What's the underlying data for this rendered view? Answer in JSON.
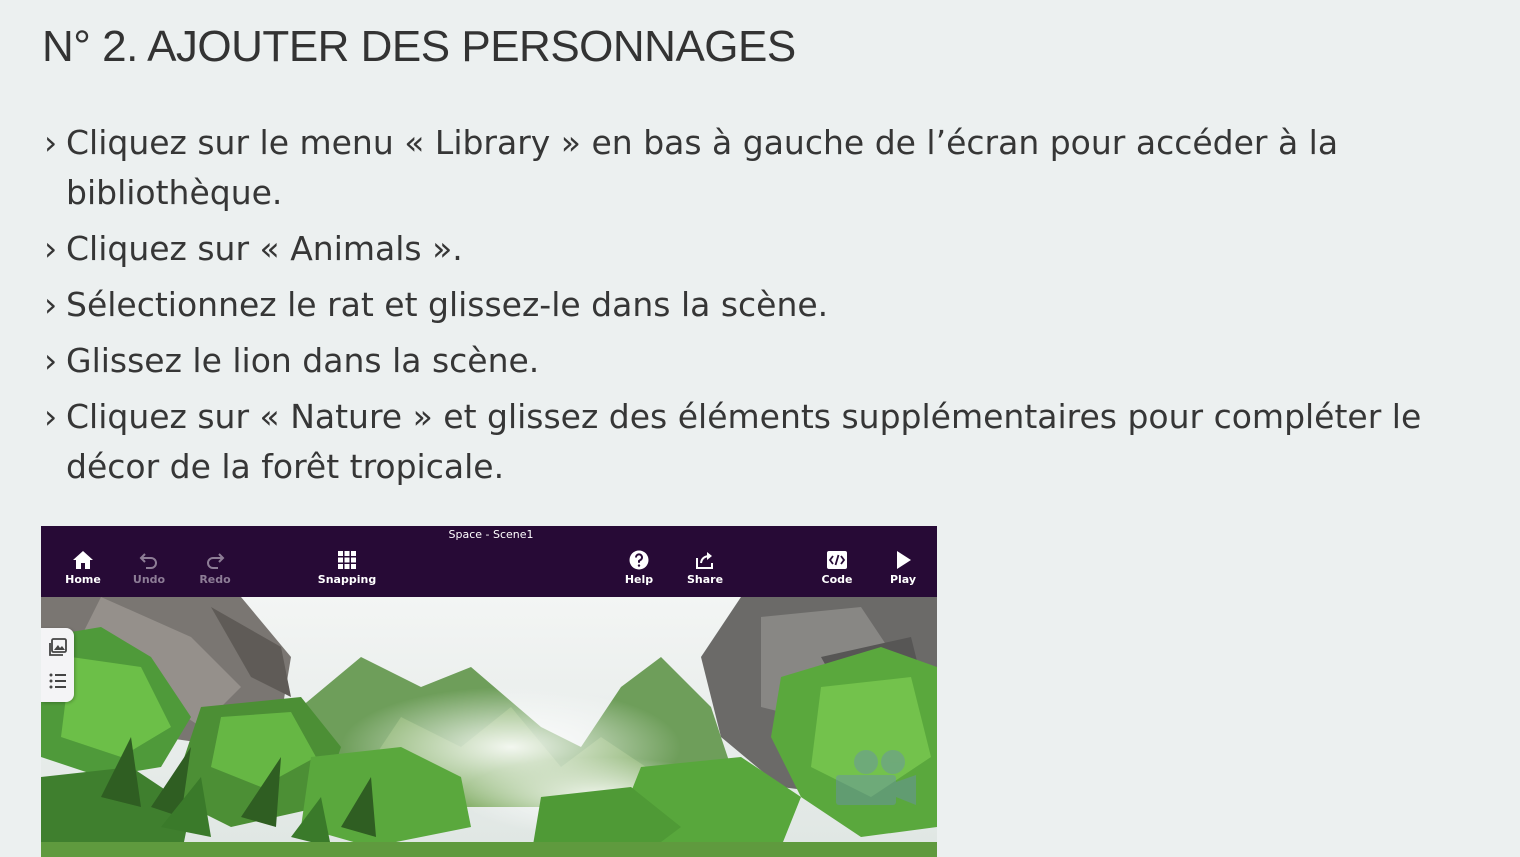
{
  "heading": "N° 2. AJOUTER DES PERSONNAGES",
  "step_marker": "›",
  "steps": [
    "Cliquez sur le menu « Library » en bas à gauche de l’écran pour accéder à la bibliothèque.",
    "Cliquez sur « Animals ».",
    "Sélectionnez le rat et glissez-le dans la scène.",
    "Glissez le lion dans la scène.",
    "Cliquez sur « Nature » et glissez des éléments supplémentaires pour compléter le décor de la forêt tropicale."
  ],
  "app": {
    "scene_title": "Space - Scene1",
    "toolbar": {
      "home": "Home",
      "undo": "Undo",
      "redo": "Redo",
      "snapping": "Snapping",
      "help": "Help",
      "share": "Share",
      "code": "Code",
      "play": "Play"
    },
    "icons": {
      "home": "home-icon",
      "undo": "undo-icon",
      "redo": "redo-icon",
      "snapping": "grid-icon",
      "help": "help-icon",
      "share": "share-icon",
      "code": "code-icon",
      "play": "play-icon",
      "library": "image-library-icon",
      "list": "list-icon"
    },
    "colors": {
      "toolbar": "#270a36",
      "disabled_label": "#8d7d96",
      "panel": "#f4f4f6"
    }
  }
}
